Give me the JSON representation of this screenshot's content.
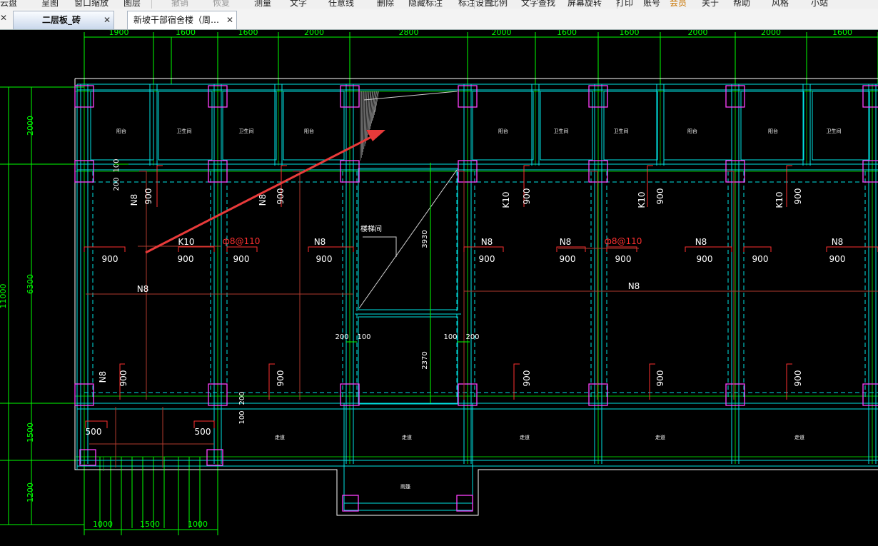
{
  "menubar": {
    "items": [
      "云盘",
      "呈图",
      "窗口缩放",
      "图层",
      "撤销",
      "恢复",
      "测量",
      "文字",
      "任意线",
      "删除",
      "隐藏标注",
      "标注设置",
      "比例",
      "文字查找",
      "屏幕旋转",
      "打印",
      "账号",
      "会员",
      "关于",
      "帮助",
      "风格",
      "小站"
    ]
  },
  "tabs": [
    {
      "label": "二层板_砖",
      "close": "✕",
      "active": true
    },
    {
      "label": "新坡干部宿舍楼（周…",
      "close": "✕",
      "active": false
    }
  ],
  "leading_close": "✕",
  "drawing": {
    "colors": {
      "background": "#000000",
      "outline": "#ffffff",
      "wall": "#00e5e5",
      "dimension": "#00ff00",
      "column": "#ff40ff",
      "rebar": "#ff3030",
      "rebar_dark": "#b03a2e",
      "text": "#ffffff",
      "arrow": "#e83a3a",
      "stair": "#d0d0d0"
    },
    "top_dims": [
      "1900",
      "1600",
      "1600",
      "2000",
      "2800",
      "2000",
      "1600",
      "1600",
      "2000",
      "2000",
      "1600"
    ],
    "left_dims": [
      "2000",
      "6300",
      "1500",
      "1200"
    ],
    "left_total": "11000",
    "bottom_dims": [
      "1000",
      "1500",
      "1000"
    ],
    "room_labels": {
      "balcony": "阳台",
      "bathroom": "卫生间",
      "corridor": "走道",
      "stair": "楼梯间",
      "stairwell_bottom": "雨篷"
    },
    "rebar_labels": {
      "n8": "N8",
      "k10": "K10",
      "phi8": "ф8@110",
      "d900": "900",
      "d500": "500",
      "d200": "200",
      "d100": "100"
    },
    "stair_dims": [
      "3930",
      "2370"
    ]
  }
}
